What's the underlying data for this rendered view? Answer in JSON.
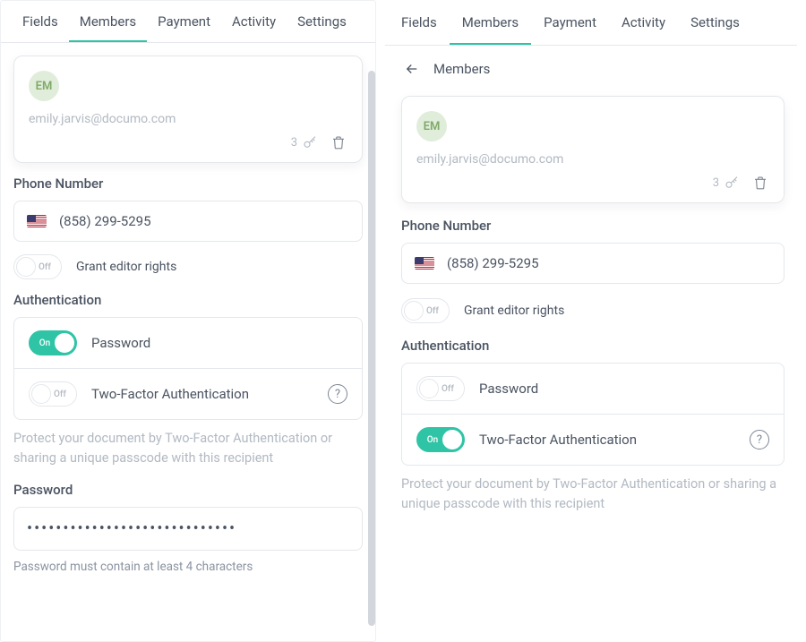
{
  "tabs": [
    "Fields",
    "Members",
    "Payment",
    "Activity",
    "Settings"
  ],
  "active_tab": "Members",
  "crumb": {
    "title": "Members"
  },
  "member": {
    "initials": "EM",
    "email": "emily.jarvis@documo.com",
    "key_count": "3"
  },
  "phone": {
    "label": "Phone Number",
    "value": "(858) 299-5295"
  },
  "editor_rights": {
    "label": "Grant editor rights",
    "state_label": "Off"
  },
  "auth": {
    "heading": "Authentication",
    "password_label": "Password",
    "twofa_label": "Two-Factor Authentication",
    "on_label": "On",
    "off_label": "Off",
    "hint": "Protect your document by Two-Factor Authentication or sharing a unique passcode with this recipient"
  },
  "password_field": {
    "label": "Password",
    "masked": "•••••••••••••••••••••••••••••",
    "help": "Password must contain at least 4 characters"
  }
}
